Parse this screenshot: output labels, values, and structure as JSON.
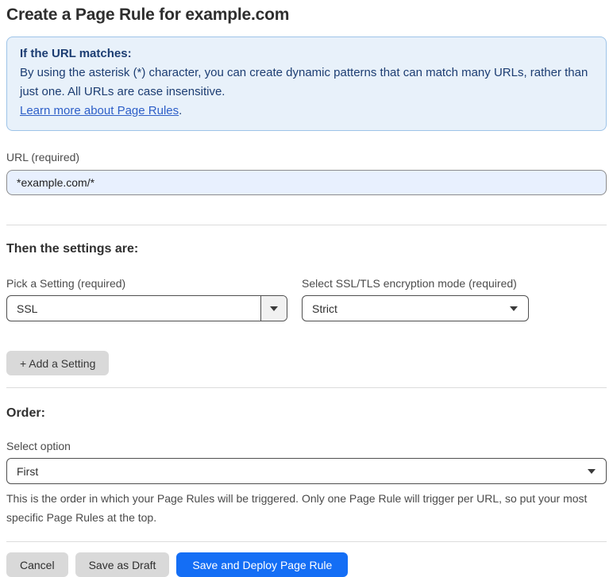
{
  "page": {
    "title": "Create a Page Rule for example.com"
  },
  "info_box": {
    "heading": "If the URL matches:",
    "body": "By using the asterisk (*) character, you can create dynamic patterns that can match many URLs, rather than just one. All URLs are case insensitive.",
    "link_label": "Learn more about Page Rules",
    "link_suffix": "."
  },
  "url_field": {
    "label": "URL (required)",
    "value": "*example.com/*"
  },
  "settings_section": {
    "heading": "Then the settings are:",
    "setting_picker": {
      "label": "Pick a Setting (required)",
      "value": "SSL"
    },
    "ssl_mode_picker": {
      "label": "Select SSL/TLS encryption mode (required)",
      "value": "Strict"
    },
    "add_setting_label": "+ Add a Setting"
  },
  "order_section": {
    "heading": "Order:",
    "select_label": "Select option",
    "value": "First",
    "help_text": "This is the order in which your Page Rules will be triggered. Only one Page Rule will trigger per URL, so put your most specific Page Rules at the top."
  },
  "footer": {
    "cancel_label": "Cancel",
    "save_draft_label": "Save as Draft",
    "save_deploy_label": "Save and Deploy Page Rule"
  },
  "colors": {
    "accent_blue": "#146ef5",
    "info_box_bg": "#e8f1fa",
    "info_box_border": "#9ec4e8",
    "info_text": "#1c3d72",
    "link_blue": "#2d5fc8",
    "url_input_bg": "#e8f0fe",
    "gray_button_bg": "#d9d9d9"
  }
}
